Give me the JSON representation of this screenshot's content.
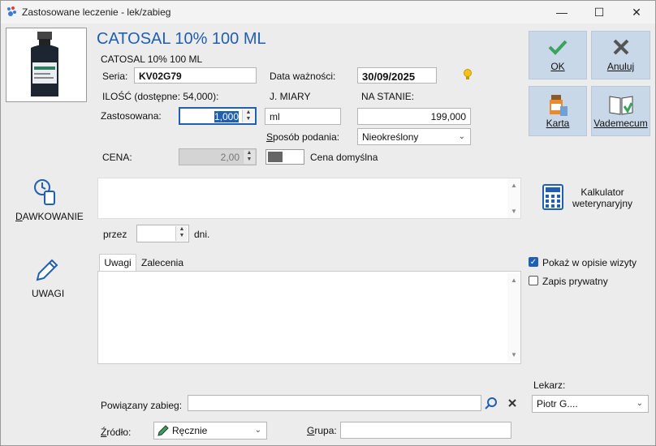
{
  "window": {
    "title": "Zastosowane leczenie - lek/zabieg",
    "minimize": "—",
    "maximize": "☐",
    "close": "✕"
  },
  "product": {
    "heading": "CATOSAL 10% 100 ML",
    "subheading": "CATOSAL 10% 100 ML"
  },
  "seria": {
    "label": "Seria:",
    "value": "KV02G79"
  },
  "expiry": {
    "label": "Data ważności:",
    "value": "30/09/2025"
  },
  "quantity": {
    "label": "ILOŚĆ (dostępne: 54,000):",
    "applied_label": "Zastosowana:",
    "applied_value": "1,000"
  },
  "unit": {
    "label": "J. MIARY",
    "value": "ml"
  },
  "stock": {
    "label": "NA STANIE:",
    "value": "199,000"
  },
  "administration": {
    "label": "Sposób podania:",
    "value": "Nieokreślony"
  },
  "price": {
    "label": "CENA:",
    "value": "2,00",
    "toggle_label": "Cena domyślna"
  },
  "buttons": {
    "ok": "OK",
    "cancel": "Anuluj",
    "card": "Karta",
    "vademecum": "Vademecum",
    "calculator": "Kalkulator weterynaryjny",
    "dosing": "DAWKOWANIE",
    "notes": "UWAGI"
  },
  "duration": {
    "prefix": "przez",
    "suffix": "dni.",
    "value": ""
  },
  "tabs": [
    {
      "label": "Uwagi",
      "active": true
    },
    {
      "label": "Zalecenia",
      "active": false
    }
  ],
  "options": {
    "show_in_visit": {
      "label": "Pokaż w opisie wizyty",
      "checked": true
    },
    "private_note": {
      "label": "Zapis prywatny",
      "checked": false
    }
  },
  "doctor": {
    "label": "Lekarz:",
    "value": "Piotr G...."
  },
  "related": {
    "label": "Powiązany zabieg:",
    "value": ""
  },
  "source": {
    "label": "Źródło:",
    "value": "Ręcznie"
  },
  "group": {
    "label": "Grupa:",
    "value": ""
  },
  "colors": {
    "heading": "#1f5fb4",
    "button_bg": "#c9d8e8",
    "ok_green": "#3aa35c",
    "accent": "#1f5fb4"
  }
}
